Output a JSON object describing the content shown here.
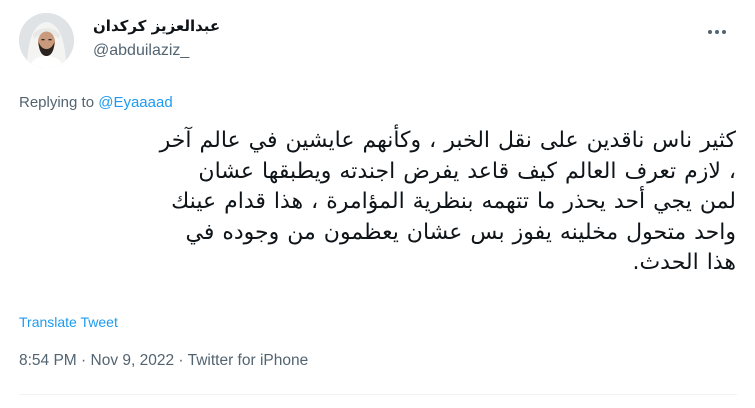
{
  "tweet": {
    "author": {
      "display_name": "عبدالعزيز كركدان",
      "handle": "@abduilaziz_",
      "avatar_icon": "profile-avatar"
    },
    "more_icon": "more-horizontal-icon",
    "replying": {
      "prefix": "Replying to ",
      "mention": "@Eyaaaad"
    },
    "text_lines": [
      "كثير ناس ناقدين على نقل الخبر ، وكأنهم عايشين في عالم آخر",
      "، لازم تعرف العالم كيف قاعد يفرض اجندته ويطبقها عشان",
      "لمن يجي أحد يحذر ما تتهمه بنظرية المؤامرة ، هذا قدام عينك",
      "واحد متحول مخلينه يفوز بس عشان يعظمون من وجوده في",
      "هذا الحدث."
    ],
    "translate_label": "Translate Tweet",
    "time": "8:54 PM",
    "separator": " · ",
    "date": "Nov 9, 2022",
    "source": "Twitter for iPhone"
  },
  "colors": {
    "text": "#0f1419",
    "secondary": "#536471",
    "link": "#1d9bf0",
    "divider": "#eff3f4"
  }
}
